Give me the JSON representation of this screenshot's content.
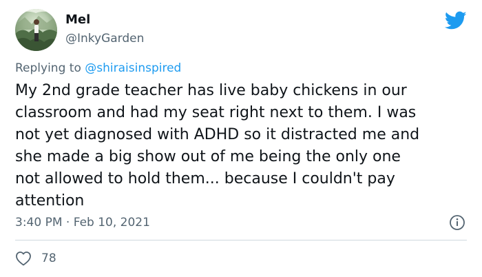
{
  "author": {
    "name": "Mel",
    "handle": "@InkyGarden"
  },
  "reply": {
    "prefix": "Replying to",
    "mention": "@shiraisinspired"
  },
  "tweet": {
    "lines": [
      "My 2nd grade teacher has live baby chickens in our",
      "classroom and had my seat right next to them. I was",
      "not yet diagnosed with ADHD so it distracted me and",
      "she made a big show out of me being the only one",
      "not allowed to hold them... because I couldn't pay",
      "attention"
    ]
  },
  "meta": {
    "time": "3:40 PM",
    "separator": "·",
    "date": "Feb 10, 2021"
  },
  "engagement": {
    "likes": "78"
  },
  "icons": {
    "brand": "twitter-bird-icon",
    "info": "info-icon",
    "like": "heart-icon"
  },
  "colors": {
    "brand": "#1d9bf0",
    "text": "#0f1419",
    "secondary": "#536471",
    "divider": "#cfd9de"
  }
}
